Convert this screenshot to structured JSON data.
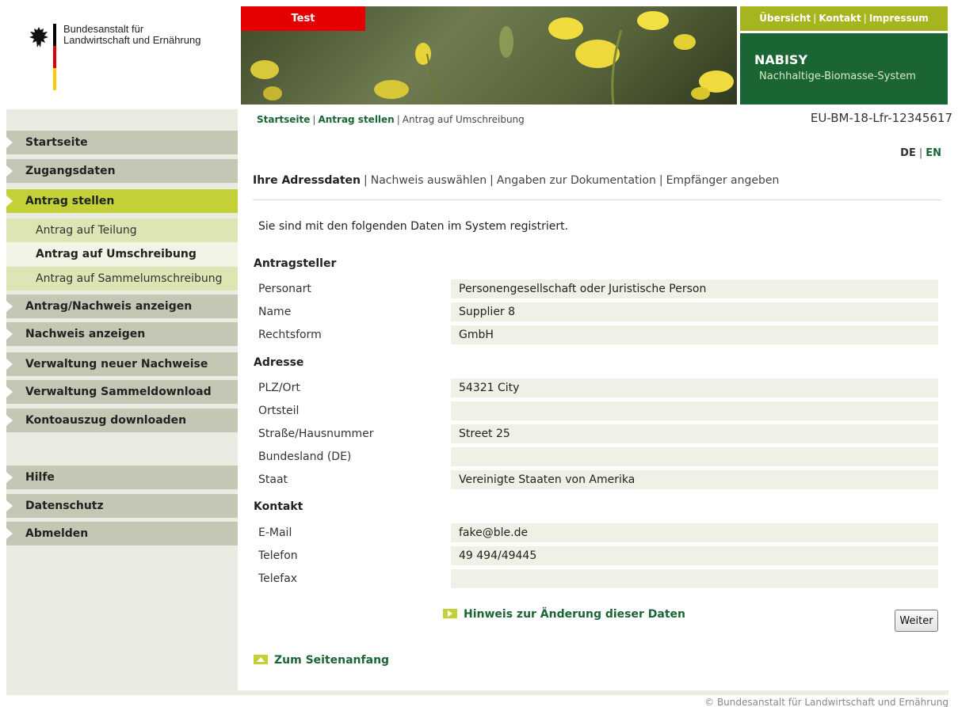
{
  "logo": {
    "line1": "Bundesanstalt für",
    "line2": "Landwirtschaft und Ernährung"
  },
  "test_badge": "Test",
  "top_nav": [
    "Übersicht",
    "Kontakt",
    "Impressum"
  ],
  "app": {
    "name": "NABISY",
    "subtitle": "Nachhaltige-Biomasse-System"
  },
  "breadcrumb": {
    "home": "Startseite",
    "section": "Antrag stellen",
    "current": "Antrag auf Umschreibung"
  },
  "account_id": "EU-BM-18-Lfr-12345617",
  "sidebar": {
    "startseite": "Startseite",
    "zugangsdaten": "Zugangsdaten",
    "antrag_stellen": "Antrag stellen",
    "sub_teilung": "Antrag auf Teilung",
    "sub_umschreibung": "Antrag auf Umschreibung",
    "sub_sammel": "Antrag auf Sammelumschreibung",
    "antrag_anzeigen": "Antrag/Nachweis anzeigen",
    "nachweis_anzeigen": "Nachweis anzeigen",
    "verwaltung_neuer": "Verwaltung neuer Nachweise",
    "verwaltung_sammel": "Verwaltung Sammeldownload",
    "kontoauszug": "Kontoauszug downloaden",
    "hilfe": "Hilfe",
    "datenschutz": "Datenschutz",
    "abmelden": "Abmelden"
  },
  "lang": {
    "de": "DE",
    "en": "EN"
  },
  "steps": [
    "Ihre Adressdaten",
    "Nachweis auswählen",
    "Angaben zur Dokumentation",
    "Empfänger angeben"
  ],
  "intro": "Sie sind mit den folgenden Daten im System registriert.",
  "antragsteller": {
    "title": "Antragsteller",
    "personart_label": "Personart",
    "personart": "Personengesellschaft oder Juristische Person",
    "name_label": "Name",
    "name": "Supplier 8",
    "rechtsform_label": "Rechtsform",
    "rechtsform": "GmbH"
  },
  "adresse": {
    "title": "Adresse",
    "plz_label": "PLZ/Ort",
    "plz": "54321 City",
    "ortsteil_label": "Ortsteil",
    "ortsteil": "",
    "strasse_label": "Straße/Hausnummer",
    "strasse": "Street 25",
    "bundesland_label": "Bundesland (DE)",
    "bundesland": "",
    "staat_label": "Staat",
    "staat": "Vereinigte Staaten von Amerika"
  },
  "kontakt": {
    "title": "Kontakt",
    "email_label": "E-Mail",
    "email": "fake@ble.de",
    "telefon_label": "Telefon",
    "telefon": "49 494/49445",
    "telefax_label": "Telefax",
    "telefax": ""
  },
  "hint_link": "Hinweis zur Änderung dieser Daten",
  "weiter_button": "Weiter",
  "to_top": "Zum Seitenanfang",
  "copyright": "© Bundesanstalt für Landwirtschaft und Ernährung",
  "colors": {
    "brand_green": "#1b6535",
    "accent_lime": "#c4d038",
    "test_red": "#e50000"
  }
}
